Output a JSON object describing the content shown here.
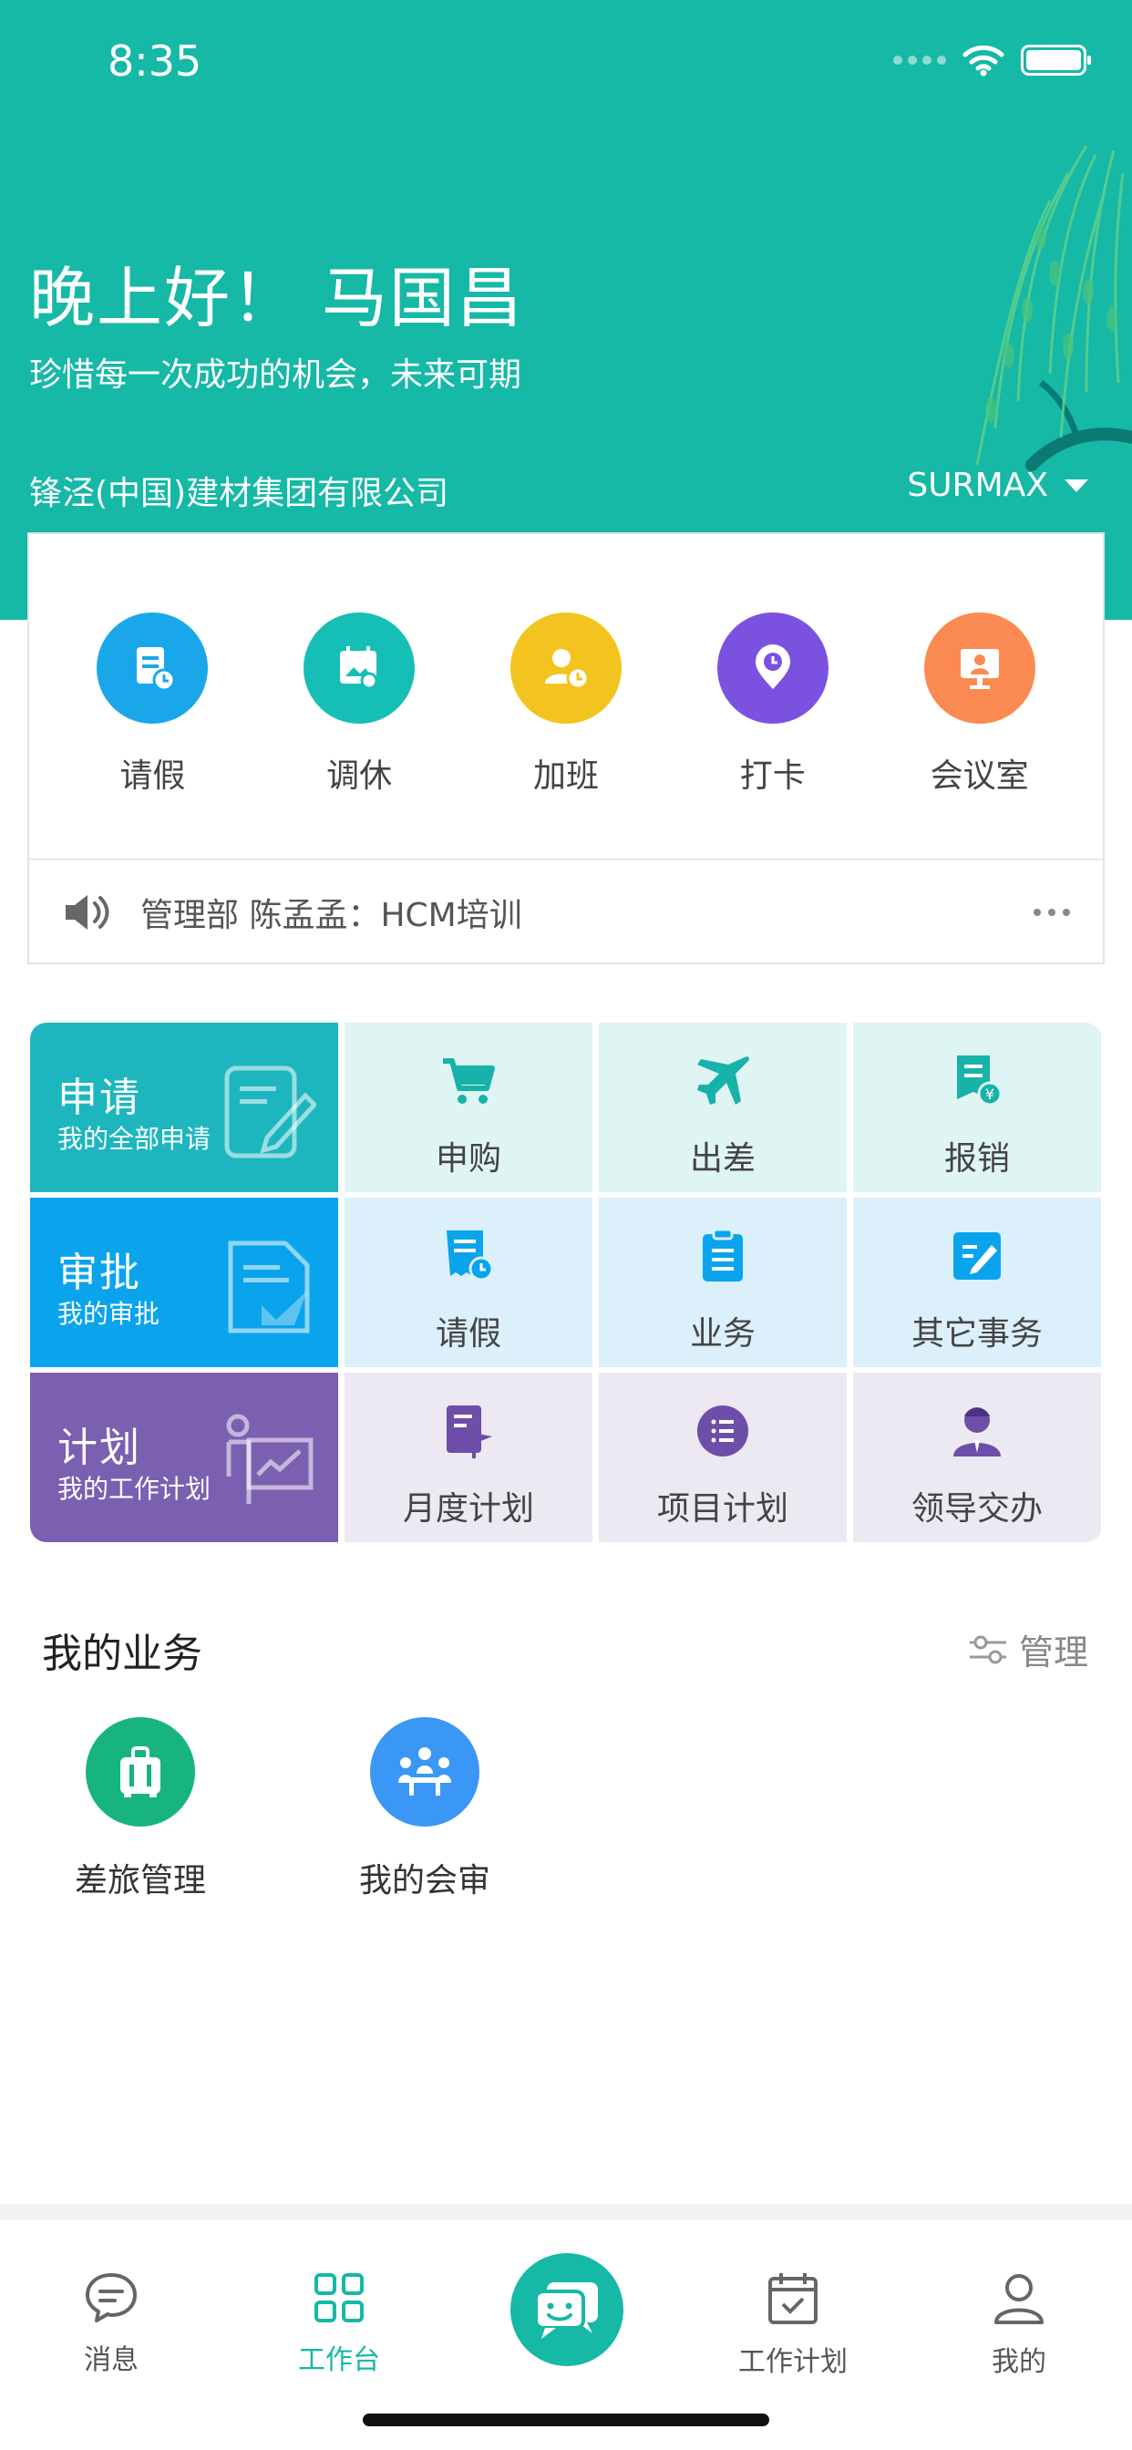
{
  "status_bar": {
    "time": "8:35"
  },
  "header": {
    "greeting": "晚上好！ 马国昌",
    "motto": "珍惜每一次成功的机会，未来可期",
    "company": "锋泾(中国)建材集团有限公司",
    "org_switch": "SURMAX"
  },
  "quick_actions": [
    {
      "label": "请假",
      "icon": "leave-form-icon",
      "color": "#1aa7ea"
    },
    {
      "label": "调休",
      "icon": "calendar-image-icon",
      "color": "#16bfb6"
    },
    {
      "label": "加班",
      "icon": "person-clock-icon",
      "color": "#f3c41f"
    },
    {
      "label": "打卡",
      "icon": "location-clock-icon",
      "color": "#7b52e0"
    },
    {
      "label": "会议室",
      "icon": "monitor-person-icon",
      "color": "#fb8a52"
    }
  ],
  "notice": {
    "text": "管理部 陈孟孟：HCM培训"
  },
  "grid": {
    "apply": {
      "title": "申请",
      "subtitle": "我的全部申请",
      "head_color": "#1db6bf",
      "cell_color": "#dff5f3",
      "items": [
        {
          "label": "申购",
          "icon": "cart-icon"
        },
        {
          "label": "出差",
          "icon": "airplane-icon"
        },
        {
          "label": "报销",
          "icon": "receipt-yen-icon"
        }
      ]
    },
    "approve": {
      "title": "审批",
      "subtitle": "我的审批",
      "head_color": "#0aa4ec",
      "cell_color": "#dcf0fb",
      "items": [
        {
          "label": "请假",
          "icon": "leave-doc-icon"
        },
        {
          "label": "业务",
          "icon": "clipboard-icon"
        },
        {
          "label": "其它事务",
          "icon": "edit-doc-icon"
        }
      ]
    },
    "plan": {
      "title": "计划",
      "subtitle": "我的工作计划",
      "head_color": "#7b5fb0",
      "cell_color": "#ece9f3",
      "items": [
        {
          "label": "月度计划",
          "icon": "flag-doc-icon"
        },
        {
          "label": "项目计划",
          "icon": "list-circle-icon"
        },
        {
          "label": "领导交办",
          "icon": "leader-icon"
        }
      ]
    }
  },
  "my_business": {
    "title": "我的业务",
    "manage_label": "管理",
    "items": [
      {
        "label": "差旅管理",
        "icon": "luggage-icon",
        "color": "#17b481"
      },
      {
        "label": "我的会审",
        "icon": "meeting-icon",
        "color": "#3a97f5"
      }
    ]
  },
  "tabbar": {
    "tabs": [
      {
        "label": "消息",
        "icon": "chat-bubble-icon"
      },
      {
        "label": "工作台",
        "icon": "grid-icon",
        "active": true
      },
      {
        "label": "",
        "icon": "chat-smile-icon"
      },
      {
        "label": "工作计划",
        "icon": "calendar-check-icon"
      },
      {
        "label": "我的",
        "icon": "user-icon"
      }
    ],
    "accent": "#16b8a6"
  }
}
